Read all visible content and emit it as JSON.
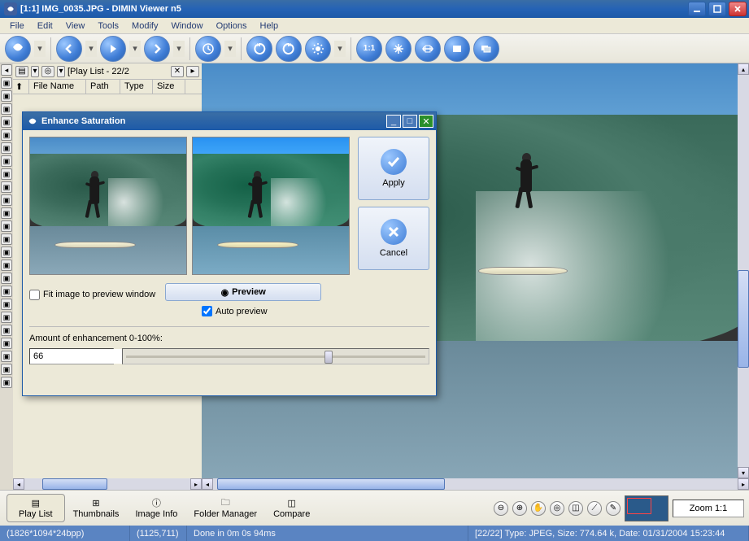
{
  "window": {
    "title": "[1:1] IMG_0035.JPG - DIMIN Viewer n5"
  },
  "menu": {
    "file": "File",
    "edit": "Edit",
    "view": "View",
    "tools": "Tools",
    "modify": "Modify",
    "window": "Window",
    "options": "Options",
    "help": "Help"
  },
  "playlist": {
    "title": "[Play List - 22/2",
    "cols": {
      "filename": "File Name",
      "path": "Path",
      "type": "Type",
      "size": "Size"
    }
  },
  "dialog": {
    "title": "Enhance Saturation",
    "apply": "Apply",
    "cancel": "Cancel",
    "preview": "Preview",
    "fit": "Fit image to preview window",
    "auto": "Auto preview",
    "amount_label": "Amount of enhancement 0-100%:",
    "amount_value": "66"
  },
  "bottom": {
    "playlist": "Play List",
    "thumbnails": "Thumbnails",
    "imageinfo": "Image Info",
    "folder": "Folder Manager",
    "compare": "Compare",
    "zoom": "Zoom 1:1"
  },
  "status": {
    "dim": "(1826*1094*24bpp)",
    "pos": "(1125,711)",
    "time": "Done in 0m 0s 94ms",
    "info": "[22/22] Type: JPEG, Size: 774.64 k, Date: 01/31/2004 15:23:44"
  }
}
